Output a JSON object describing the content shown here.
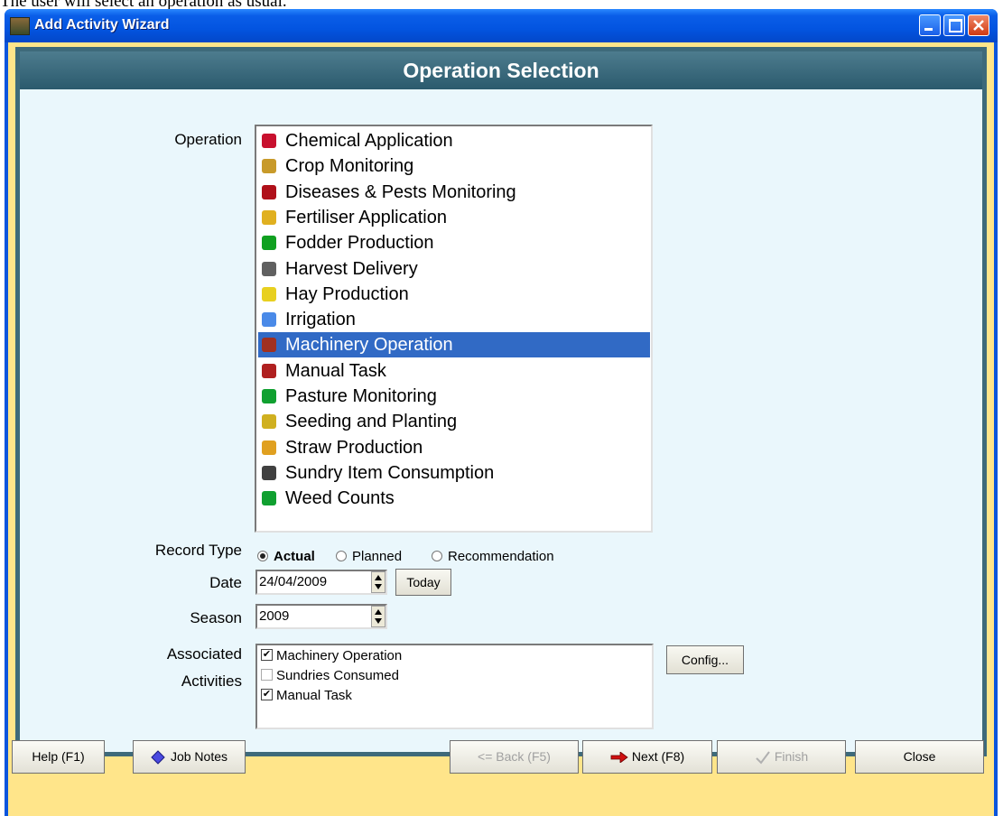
{
  "caption": "The user will select an operation as usual.",
  "window": {
    "title": "Add Activity Wizard"
  },
  "header": {
    "title": "Operation Selection"
  },
  "operation": {
    "label": "Operation",
    "items": [
      {
        "label": "Chemical Application",
        "icon": "chemical-icon",
        "color": "#c8102e"
      },
      {
        "label": "Crop Monitoring",
        "icon": "crop-icon",
        "color": "#c89a2a"
      },
      {
        "label": "Diseases & Pests Monitoring",
        "icon": "bug-icon",
        "color": "#b0101a"
      },
      {
        "label": "Fertiliser Application",
        "icon": "fertiliser-icon",
        "color": "#e0b020"
      },
      {
        "label": "Fodder Production",
        "icon": "fodder-icon",
        "color": "#10a020"
      },
      {
        "label": "Harvest Delivery",
        "icon": "harvest-icon",
        "color": "#606060"
      },
      {
        "label": "Hay Production",
        "icon": "hay-icon",
        "color": "#e8d020"
      },
      {
        "label": "Irrigation",
        "icon": "water-drop-icon",
        "color": "#4a8ae8"
      },
      {
        "label": "Machinery Operation",
        "icon": "tractor-icon",
        "color": "#a03020",
        "selected": true
      },
      {
        "label": "Manual Task",
        "icon": "hand-icon",
        "color": "#b02020"
      },
      {
        "label": "Pasture Monitoring",
        "icon": "pasture-icon",
        "color": "#10a030"
      },
      {
        "label": "Seeding and Planting",
        "icon": "seed-icon",
        "color": "#d0b020"
      },
      {
        "label": "Straw Production",
        "icon": "straw-icon",
        "color": "#e0a020"
      },
      {
        "label": "Sundry Item Consumption",
        "icon": "hammer-icon",
        "color": "#404040"
      },
      {
        "label": "Weed Counts",
        "icon": "weed-icon",
        "color": "#10a030"
      }
    ]
  },
  "record_type": {
    "label": "Record Type",
    "options": [
      {
        "label": "Actual",
        "checked": true
      },
      {
        "label": "Planned",
        "checked": false
      },
      {
        "label": "Recommendation",
        "checked": false
      }
    ]
  },
  "date": {
    "label": "Date",
    "value": "24/04/2009",
    "today_label": "Today"
  },
  "season": {
    "label": "Season",
    "value": "2009"
  },
  "associated": {
    "label_line1": "Associated",
    "label_line2": "Activities",
    "items": [
      {
        "label": "Machinery Operation",
        "checked": true
      },
      {
        "label": "Sundries Consumed",
        "checked": false
      },
      {
        "label": "Manual Task",
        "checked": true
      }
    ],
    "config_label": "Config..."
  },
  "footer": {
    "help_label": "Help (F1)",
    "job_notes_label": "Job Notes",
    "back_label": "Back (F5)",
    "next_label": "Next (F8)",
    "finish_label": "Finish",
    "close_label": "Close"
  },
  "colors": {
    "titlebar": "#0a55dd",
    "header": "#3e6a7a",
    "body": "#eaf7fc",
    "footer": "#ffe58a",
    "selection": "#316ac5"
  }
}
